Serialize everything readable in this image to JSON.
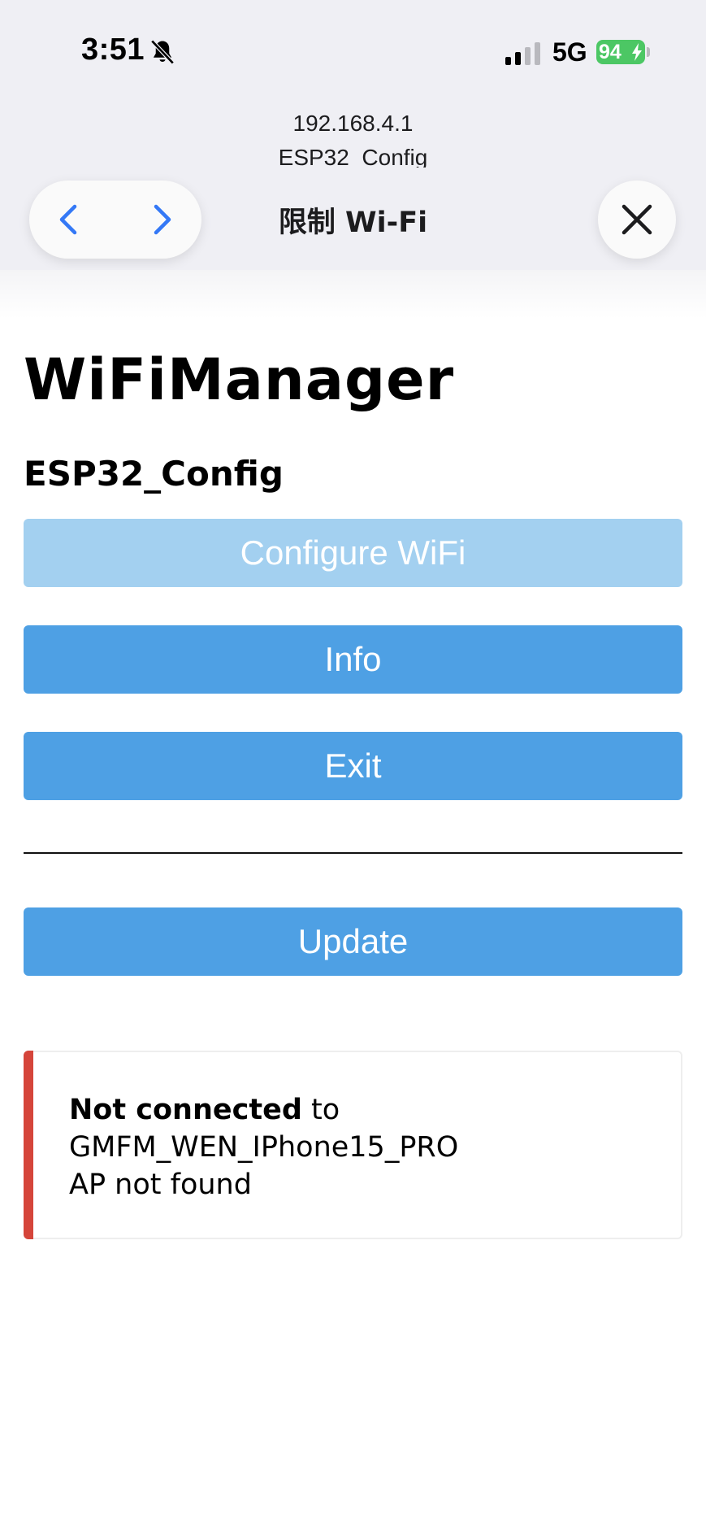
{
  "status_bar": {
    "time": "3:51",
    "network": "5G",
    "battery": "94",
    "icons": [
      "bell-slash-icon",
      "cellular-signal-icon",
      "battery-charging-icon"
    ]
  },
  "browser": {
    "url_line1": "192.168.4.1",
    "url_line2": "ESP32_Config",
    "title": "限制 Wi-Fi"
  },
  "page": {
    "heading": "WiFiManager",
    "subheading": "ESP32_Config",
    "buttons": {
      "configure": "Configure WiFi",
      "info": "Info",
      "exit": "Exit",
      "update": "Update"
    },
    "status_message": {
      "bold": "Not connected",
      "connector": " to",
      "ssid": "GMFM_WEN_IPhone15_PRO",
      "detail": "AP not found"
    }
  },
  "colors": {
    "button": "#4ea0e4",
    "button_disabled": "#a3d0f0",
    "error_bar": "#d5453a",
    "battery": "#4cc764"
  }
}
